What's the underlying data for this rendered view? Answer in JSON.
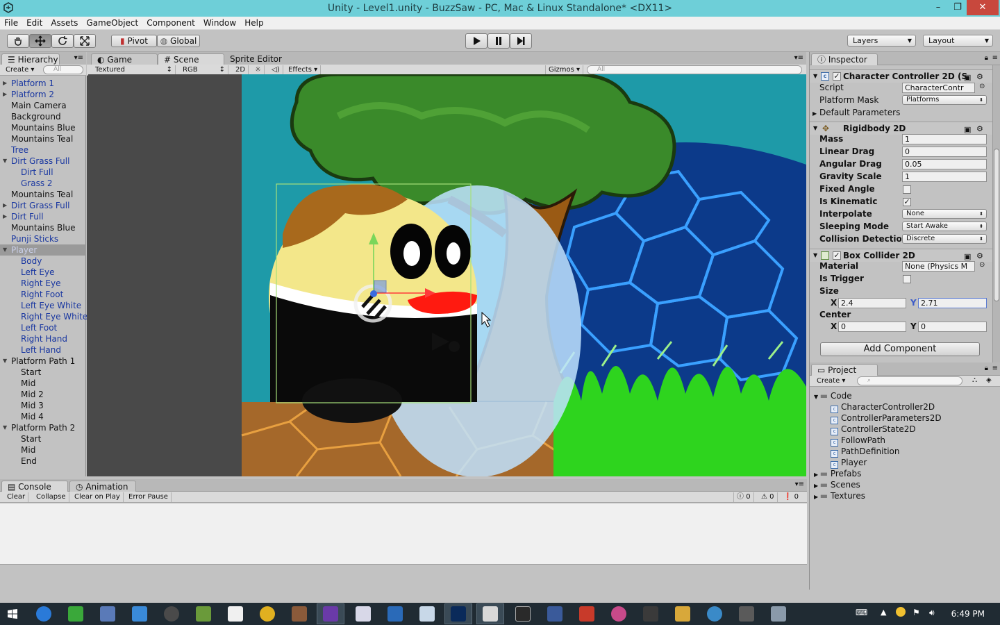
{
  "window": {
    "title": "Unity - Level1.unity - BuzzSaw - PC, Mac & Linux Standalone* <DX11>",
    "minimize": "–",
    "maximize": "❐",
    "close": "✕"
  },
  "menu": [
    "File",
    "Edit",
    "Assets",
    "GameObject",
    "Component",
    "Window",
    "Help"
  ],
  "toolbar": {
    "pivot": "Pivot",
    "global": "Global",
    "layers": "Layers",
    "layout": "Layout"
  },
  "hierarchy": {
    "tab": "Hierarchy",
    "create": "Create",
    "search_placeholder": "All",
    "items": [
      {
        "label": "Platform 1",
        "prefab": true,
        "expand": "right",
        "indent": 0
      },
      {
        "label": "Platform 2",
        "prefab": true,
        "expand": "right",
        "indent": 0
      },
      {
        "label": "Main Camera",
        "prefab": false,
        "expand": "",
        "indent": 0
      },
      {
        "label": "Background",
        "prefab": false,
        "expand": "",
        "indent": 0
      },
      {
        "label": "Mountains Blue",
        "prefab": false,
        "expand": "",
        "indent": 0
      },
      {
        "label": "Mountains Teal",
        "prefab": false,
        "expand": "",
        "indent": 0
      },
      {
        "label": "Tree",
        "prefab": true,
        "expand": "",
        "indent": 0
      },
      {
        "label": "Dirt Grass Full",
        "prefab": true,
        "expand": "down",
        "indent": 0
      },
      {
        "label": "Dirt Full",
        "prefab": true,
        "expand": "",
        "indent": 1
      },
      {
        "label": "Grass 2",
        "prefab": true,
        "expand": "",
        "indent": 1
      },
      {
        "label": "Mountains Teal",
        "prefab": false,
        "expand": "",
        "indent": 0
      },
      {
        "label": "Dirt Grass Full",
        "prefab": true,
        "expand": "right",
        "indent": 0
      },
      {
        "label": "Dirt Full",
        "prefab": true,
        "expand": "right",
        "indent": 0
      },
      {
        "label": "Mountains Blue",
        "prefab": false,
        "expand": "",
        "indent": 0
      },
      {
        "label": "Punji Sticks",
        "prefab": true,
        "expand": "",
        "indent": 0
      },
      {
        "label": "Player",
        "prefab": true,
        "expand": "down",
        "indent": 0,
        "selected": true
      },
      {
        "label": "Body",
        "prefab": true,
        "expand": "",
        "indent": 1
      },
      {
        "label": "Left Eye",
        "prefab": true,
        "expand": "",
        "indent": 1
      },
      {
        "label": "Right Eye",
        "prefab": true,
        "expand": "",
        "indent": 1
      },
      {
        "label": "Right Foot",
        "prefab": true,
        "expand": "",
        "indent": 1
      },
      {
        "label": "Left Eye White",
        "prefab": true,
        "expand": "",
        "indent": 1
      },
      {
        "label": "Right Eye White",
        "prefab": true,
        "expand": "",
        "indent": 1
      },
      {
        "label": "Left Foot",
        "prefab": true,
        "expand": "",
        "indent": 1
      },
      {
        "label": "Right Hand",
        "prefab": true,
        "expand": "",
        "indent": 1
      },
      {
        "label": "Left Hand",
        "prefab": true,
        "expand": "",
        "indent": 1
      },
      {
        "label": "Platform Path 1",
        "prefab": false,
        "expand": "down",
        "indent": 0
      },
      {
        "label": "Start",
        "prefab": false,
        "expand": "",
        "indent": 1
      },
      {
        "label": "Mid",
        "prefab": false,
        "expand": "",
        "indent": 1
      },
      {
        "label": "Mid 2",
        "prefab": false,
        "expand": "",
        "indent": 1
      },
      {
        "label": "Mid 3",
        "prefab": false,
        "expand": "",
        "indent": 1
      },
      {
        "label": "Mid 4",
        "prefab": false,
        "expand": "",
        "indent": 1
      },
      {
        "label": "Platform Path 2",
        "prefab": false,
        "expand": "down",
        "indent": 0
      },
      {
        "label": "Start",
        "prefab": false,
        "expand": "",
        "indent": 1
      },
      {
        "label": "Mid",
        "prefab": false,
        "expand": "",
        "indent": 1
      },
      {
        "label": "End",
        "prefab": false,
        "expand": "",
        "indent": 1
      }
    ]
  },
  "scene": {
    "tabs": [
      "Game",
      "Scene",
      "Sprite Editor"
    ],
    "render_mode": "Textured",
    "color_mode": "RGB",
    "mode_2d": "2D",
    "effects": "Effects",
    "gizmos": "Gizmos",
    "search_placeholder": "All"
  },
  "inspector": {
    "tab": "Inspector",
    "character_controller": {
      "title": "Character Controller 2D (S",
      "script_label": "Script",
      "script_value": "CharacterContr",
      "platform_mask_label": "Platform Mask",
      "platform_mask_value": "Platforms",
      "default_params": "Default Parameters"
    },
    "rigidbody": {
      "title": "Rigidbody 2D",
      "mass_label": "Mass",
      "mass": "1",
      "linear_drag_label": "Linear Drag",
      "linear_drag": "0",
      "angular_drag_label": "Angular Drag",
      "angular_drag": "0.05",
      "gravity_label": "Gravity Scale",
      "gravity": "1",
      "fixed_angle_label": "Fixed Angle",
      "kinematic_label": "Is Kinematic",
      "interpolate_label": "Interpolate",
      "interpolate": "None",
      "sleeping_label": "Sleeping Mode",
      "sleeping": "Start Awake",
      "collision_label": "Collision Detection",
      "collision": "Discrete"
    },
    "box_collider": {
      "title": "Box Collider 2D",
      "material_label": "Material",
      "material": "None (Physics M",
      "trigger_label": "Is Trigger",
      "size_label": "Size",
      "size_x_label": "X",
      "size_x": "2.4",
      "size_y_label": "Y",
      "size_y": "2.71",
      "center_label": "Center",
      "center_x_label": "X",
      "center_x": "0",
      "center_y_label": "Y",
      "center_y": "0"
    },
    "add_component": "Add Component"
  },
  "project": {
    "tab": "Project",
    "create": "Create",
    "folders": [
      {
        "label": "Code",
        "open": true
      },
      {
        "label": "Prefabs",
        "open": false
      },
      {
        "label": "Scenes",
        "open": false
      },
      {
        "label": "Textures",
        "open": false
      }
    ],
    "scripts": [
      "CharacterController2D",
      "ControllerParameters2D",
      "ControllerState2D",
      "FollowPath",
      "PathDefinition",
      "Player"
    ]
  },
  "console": {
    "tabs": [
      "Console",
      "Animation"
    ],
    "buttons": [
      "Clear",
      "Collapse",
      "Clear on Play",
      "Error Pause"
    ],
    "info_count": "0",
    "warning_count": "0",
    "error_count": "0"
  },
  "taskbar": {
    "clock": "6:49 PM"
  },
  "colors": {
    "title_bar": "#6ecfd8",
    "prefab_text": "#1836a0",
    "taskbar": "#202b33",
    "sky": "#1e9aa8",
    "ground": "#a5682a",
    "grass": "#2ed41e"
  }
}
